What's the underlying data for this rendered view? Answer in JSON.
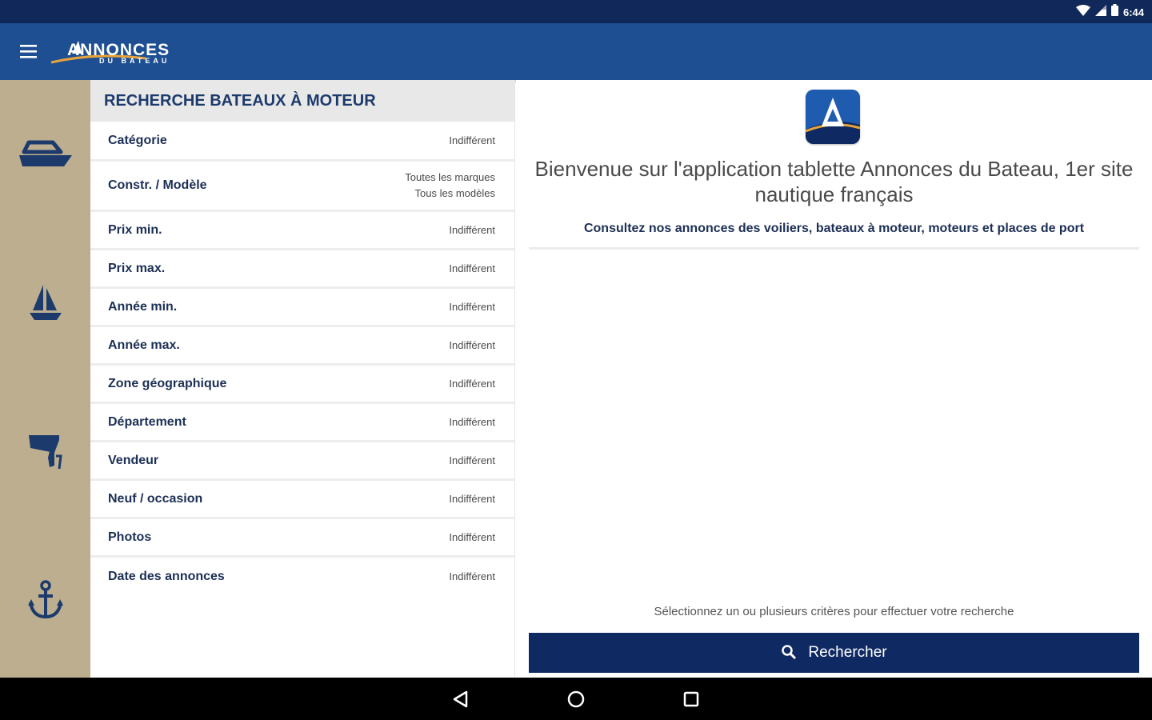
{
  "status_bar": {
    "time": "6:44",
    "icons": [
      "wifi-icon",
      "cell-signal-icon",
      "battery-icon"
    ]
  },
  "app_bar": {
    "menu_icon": "hamburger-menu-icon",
    "logo": {
      "line1": "ANNONCES",
      "line2": "DU BATEAU"
    }
  },
  "side_rail": {
    "items": [
      {
        "icon": "motorboat-icon"
      },
      {
        "icon": "sailboat-icon"
      },
      {
        "icon": "outboard-motor-icon"
      },
      {
        "icon": "anchor-icon"
      }
    ]
  },
  "search_form": {
    "title": "RECHERCHE BATEAUX À MOTEUR",
    "criteria": [
      {
        "label": "Catégorie",
        "value": "Indifférent"
      },
      {
        "label": "Constr. / Modèle",
        "value": "Toutes les marques",
        "value2": "Tous les modèles"
      },
      {
        "label": "Prix min.",
        "value": "Indifférent"
      },
      {
        "label": "Prix max.",
        "value": "Indifférent"
      },
      {
        "label": "Année min.",
        "value": "Indifférent"
      },
      {
        "label": "Année max.",
        "value": "Indifférent"
      },
      {
        "label": "Zone géographique",
        "value": "Indifférent"
      },
      {
        "label": "Département",
        "value": "Indifférent"
      },
      {
        "label": "Vendeur",
        "value": "Indifférent"
      },
      {
        "label": "Neuf / occasion",
        "value": "Indifférent"
      },
      {
        "label": "Photos",
        "value": "Indifférent"
      },
      {
        "label": "Date des annonces",
        "value": "Indifférent"
      }
    ]
  },
  "welcome": {
    "app_icon_letter": "A",
    "title": "Bienvenue sur l'application tablette Annonces du Bateau, 1er site nautique français",
    "subtitle": "Consultez nos annonces des voiliers, bateaux à moteur, moteurs et places de port",
    "hint": "Sélectionnez un ou plusieurs critères pour effectuer votre recherche",
    "search_button": {
      "label": "Rechercher",
      "icon": "search-icon"
    }
  },
  "nav_bar": {
    "buttons": [
      "back-icon",
      "home-icon",
      "recents-icon"
    ]
  },
  "colors": {
    "status_bar": "#11295a",
    "app_bar": "#1d4f92",
    "side_rail": "#bdae90",
    "rail_icons": "#1c3a6b",
    "header_bg": "#e8e8e8",
    "button": "#0f2a62"
  }
}
